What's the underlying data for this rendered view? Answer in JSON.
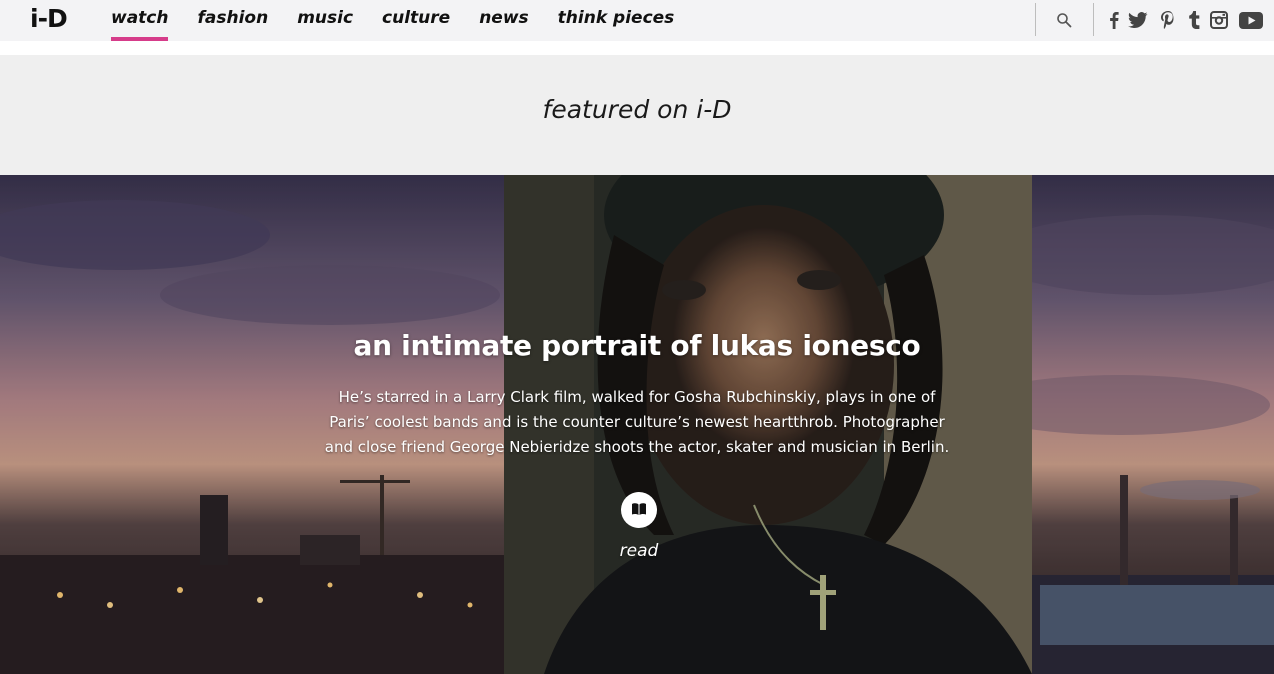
{
  "header": {
    "logo": "i-D",
    "nav": [
      {
        "label": "watch",
        "active": true
      },
      {
        "label": "fashion",
        "active": false
      },
      {
        "label": "music",
        "active": false
      },
      {
        "label": "culture",
        "active": false
      },
      {
        "label": "news",
        "active": false
      },
      {
        "label": "think pieces",
        "active": false
      }
    ],
    "accent_color": "#d63c8a",
    "icons": [
      "search-icon",
      "facebook-icon",
      "twitter-icon",
      "pinterest-icon",
      "tumblr-icon",
      "instagram-icon",
      "youtube-icon"
    ]
  },
  "featured": {
    "heading": "featured on i-D"
  },
  "hero": {
    "title": "an intimate portrait of lukas ionesco",
    "description": "He’s starred in a Larry Clark film, walked for Gosha Rubchinskiy, plays in one of Paris’ coolest bands and is the counter culture’s newest heartthrob. Photographer and close friend George Nebieridze shoots the actor, skater and musician in Berlin.",
    "read_label": "read",
    "read_icon": "book-icon"
  }
}
